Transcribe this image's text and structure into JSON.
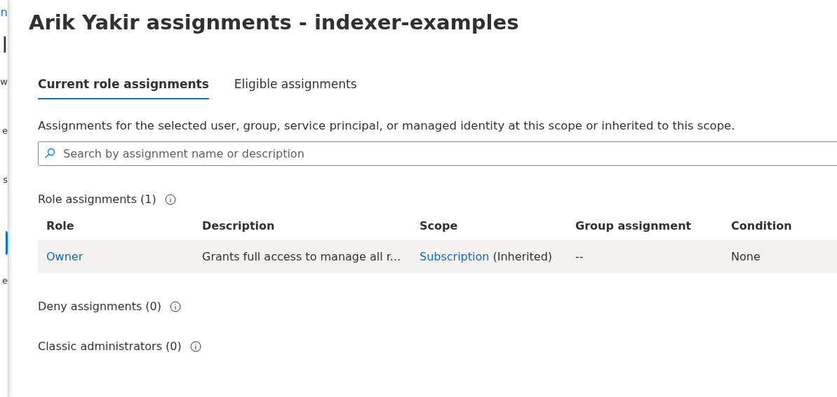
{
  "background_page": {
    "fragments": [
      {
        "text": "n",
        "kind": "link"
      },
      {
        "text": "l",
        "kind": "heading"
      },
      {
        "text": "w",
        "kind": "text"
      },
      {
        "text": "e",
        "kind": "text"
      },
      {
        "text": "s",
        "kind": "text"
      },
      {
        "kind": "button"
      },
      {
        "text": "e",
        "kind": "text"
      }
    ]
  },
  "title": "Arik Yakir assignments - indexer-examples",
  "tabs": [
    {
      "label": "Current role assignments",
      "selected": true
    },
    {
      "label": "Eligible assignments",
      "selected": false
    }
  ],
  "description": "Assignments for the selected user, group, service principal, or managed identity at this scope or inherited to this scope.",
  "search": {
    "placeholder": "Search by assignment name or description"
  },
  "role_assignments": {
    "heading": "Role assignments (1)",
    "columns": [
      "Role",
      "Description",
      "Scope",
      "Group assignment",
      "Condition"
    ],
    "rows": [
      {
        "role": "Owner",
        "description": "Grants full access to manage all r...",
        "scope_link": "Subscription",
        "scope_note": "(Inherited)",
        "group_assignment": "--",
        "condition": "None"
      }
    ]
  },
  "sections": [
    {
      "heading": "Deny assignments (0)"
    },
    {
      "heading": "Classic administrators (0)"
    }
  ]
}
